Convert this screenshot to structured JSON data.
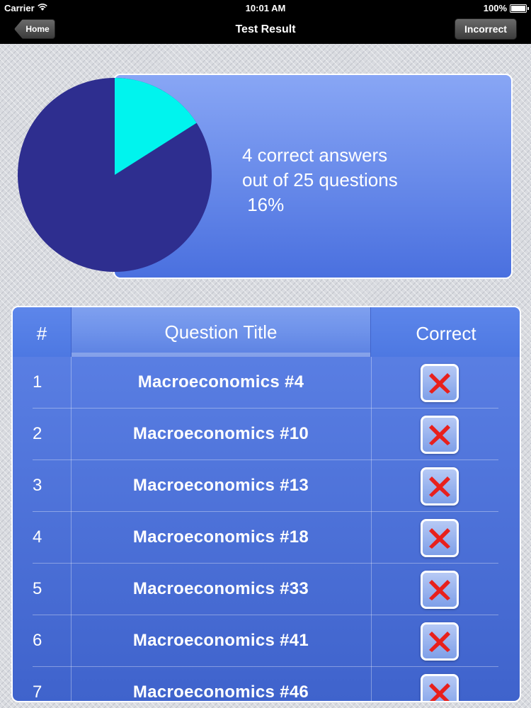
{
  "status_bar": {
    "carrier": "Carrier",
    "time": "10:01 AM",
    "battery": "100%",
    "icons": [
      "wifi-icon",
      "battery-icon"
    ]
  },
  "nav": {
    "title": "Test Result",
    "back_label": "Home",
    "right_label": "Incorrect"
  },
  "summary": {
    "line1": "4 correct answers",
    "line2": "out of 25 questions",
    "line3": " 16%",
    "correct_fraction": 0.16,
    "colors": {
      "correct": "#00f4ee",
      "incorrect": "#2e2e8f"
    }
  },
  "table": {
    "headers": {
      "num": "#",
      "title": "Question Title",
      "correct": "Correct"
    },
    "rows": [
      {
        "num": "1",
        "title": "Macroeconomics #4",
        "correct": false
      },
      {
        "num": "2",
        "title": "Macroeconomics #10",
        "correct": false
      },
      {
        "num": "3",
        "title": "Macroeconomics #13",
        "correct": false
      },
      {
        "num": "4",
        "title": "Macroeconomics #18",
        "correct": false
      },
      {
        "num": "5",
        "title": "Macroeconomics #33",
        "correct": false
      },
      {
        "num": "6",
        "title": "Macroeconomics #41",
        "correct": false
      },
      {
        "num": "7",
        "title": "Macroeconomics #46",
        "correct": false
      }
    ],
    "incorrect_icon": "red-x-icon",
    "x_color": "#e8201c"
  }
}
